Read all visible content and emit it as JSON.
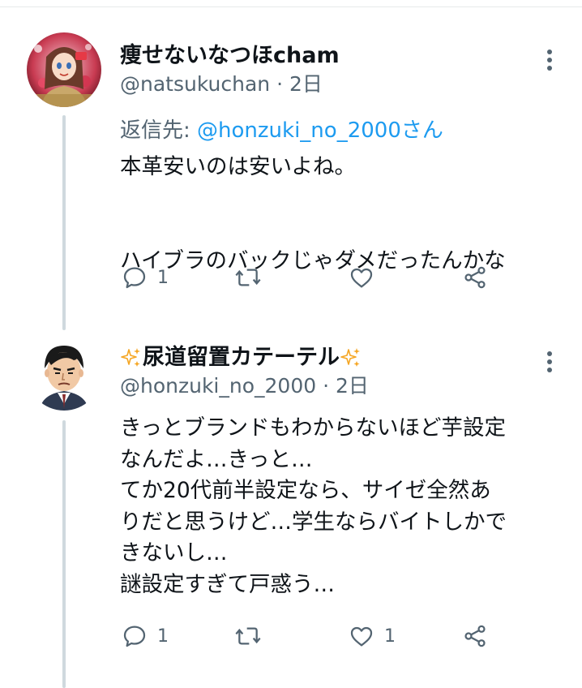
{
  "tweets": [
    {
      "display_name": "痩せないなつほcham",
      "handle": "@natsukuchan",
      "separator": "·",
      "time": "2日",
      "reply_to_label": "返信先: ",
      "reply_to_mention": "@honzuki_no_2000さん",
      "lines": [
        "本革安いのは安いよね。",
        "",
        "ハイブラのバックじゃダメだったんかな"
      ],
      "reply_count": "1",
      "retweet_count": "",
      "like_count": ""
    },
    {
      "display_name": "尿道留置カテーテル",
      "handle": "@honzuki_no_2000",
      "separator": "·",
      "time": "2日",
      "lines": [
        "きっとブランドもわからないほど芋設定",
        "なんだよ…きっと…",
        "てか20代前半設定なら、サイゼ全然あ",
        "りだと思うけど…学生ならバイトしかで",
        "きないし…",
        "謎設定すぎて戸惑う…"
      ],
      "reply_count": "1",
      "retweet_count": "",
      "like_count": "1"
    }
  ],
  "colors": {
    "text": "#0f1419",
    "secondary": "#536471",
    "link": "#1d9bf0",
    "thread_line": "#cfd9de",
    "sparkle": "#f5a623"
  }
}
